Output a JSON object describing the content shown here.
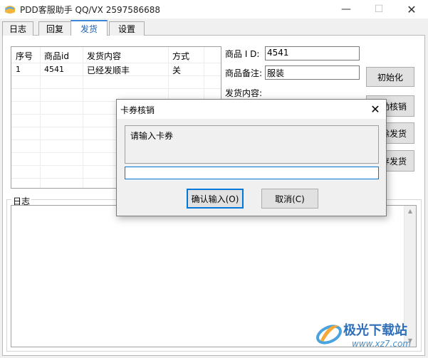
{
  "window": {
    "title": "PDD客服助手 QQ/VX 2597586688",
    "minimize_glyph": "—",
    "maximize_glyph": "☐",
    "close_glyph": "✕"
  },
  "tabs": [
    {
      "label": "日志",
      "active": false
    },
    {
      "label": "回复",
      "active": false
    },
    {
      "label": "发货",
      "active": true
    },
    {
      "label": "设置",
      "active": false
    }
  ],
  "list": {
    "columns": [
      "序号",
      "商品id",
      "发货内容",
      "方式"
    ],
    "rows": [
      {
        "index": "1",
        "product_id": "4541",
        "content": "已经发顺丰",
        "mode": "关"
      }
    ]
  },
  "form": {
    "product_id_label": "商品 I D:",
    "product_id_value": "4541",
    "note_label": "商品备注:",
    "note_value": "服装",
    "content_label": "发货内容:",
    "init_button": "初始化",
    "btn2": "动核销",
    "btn3": "除发货",
    "btn4": "存发货"
  },
  "log": {
    "group_label": "日志"
  },
  "dialog": {
    "title": "卡券核销",
    "message": "请输入卡券",
    "input_value": "",
    "ok_button": "确认输入(O)",
    "cancel_button": "取消(C)",
    "close_glyph": "✕"
  },
  "watermark": {
    "text": "极光下载站",
    "url": "www.xz7.com"
  },
  "colors": {
    "accent": "#0078d7",
    "active_tab": "#3c86d8",
    "watermark_blue": "#2e6fb8"
  }
}
